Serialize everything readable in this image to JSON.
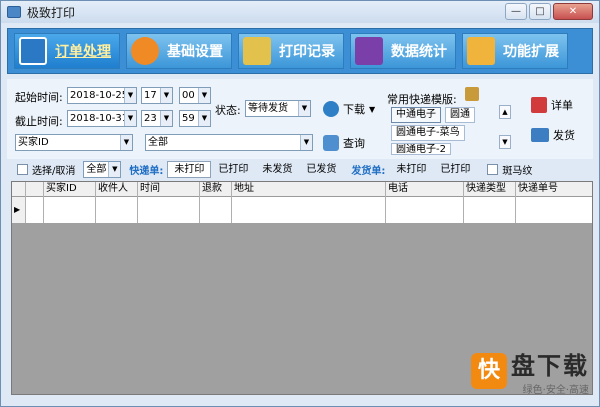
{
  "window": {
    "title": "极致打印"
  },
  "nav": [
    {
      "label": "订单处理",
      "active": true,
      "icon": "order-icon",
      "color": "#2b78c4"
    },
    {
      "label": "基础设置",
      "active": false,
      "icon": "settings-gear-icon",
      "color": "#f08a24"
    },
    {
      "label": "打印记录",
      "active": false,
      "icon": "print-record-icon",
      "color": "#e2c24d"
    },
    {
      "label": "数据统计",
      "active": false,
      "icon": "chart-icon",
      "color": "#7a3fa8"
    },
    {
      "label": "功能扩展",
      "active": false,
      "icon": "extension-icon",
      "color": "#f0b43c"
    }
  ],
  "form": {
    "start_label": "起始时间:",
    "start_date": "2018-10-25",
    "start_hour": "17",
    "start_min": "00",
    "end_label": "截止时间:",
    "end_date": "2018-10-31",
    "end_hour": "23",
    "end_min": "59",
    "status_label": "状态:",
    "status_value": "等待发货",
    "download_label": "下载",
    "buyer_field": "买家ID",
    "buyer_value": "全部",
    "query_label": "查询",
    "templates_label": "常用快递模版:",
    "templates": [
      "中通电子",
      "圆通",
      "圆通电子-菜鸟",
      "圆通电子-2"
    ],
    "detail_label": "详单",
    "ship_label": "发货"
  },
  "filter": {
    "select_all": "选择/取消",
    "scope": "全部",
    "express_label": "快递单:",
    "express_opts": [
      "未打印",
      "已打印",
      "未发货",
      "已发货"
    ],
    "delivery_label": "发货单:",
    "delivery_opts": [
      "未打印",
      "已打印"
    ],
    "zebra": "斑马纹"
  },
  "grid": {
    "columns": [
      "买家ID",
      "收件人",
      "时间",
      "退款",
      "地址",
      "电话",
      "快递类型",
      "快递单号"
    ]
  },
  "watermark": {
    "mark": "快",
    "big": "盘下载",
    "small": "绿色·安全·高速"
  }
}
